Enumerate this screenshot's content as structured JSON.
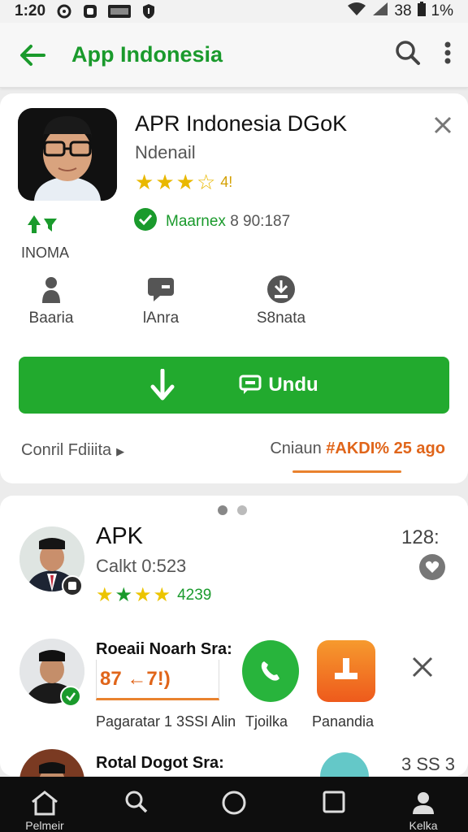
{
  "status_bar": {
    "time": "1:20",
    "battery": "38",
    "percent": "1%"
  },
  "app_bar": {
    "title": "App Indonesia"
  },
  "detail": {
    "app_name": "APR Indonesia DGoK",
    "developer": "Ndenail",
    "rating_value": "4!",
    "verified_label": "Maarnex",
    "verified_number": "8 90:187",
    "update_label": "INOMA",
    "stats": [
      {
        "label": "Baaria",
        "icon": "person-icon"
      },
      {
        "label": "lAnra",
        "icon": "message-icon"
      },
      {
        "label": "S8nata",
        "icon": "download-badge-icon"
      }
    ],
    "install_label": "Undu",
    "footer_left": "Conril Fdiiita",
    "footer_right_prefix": "Cniaun",
    "footer_right_accent": "#AKDI% 25 ago",
    "colors": {
      "accent": "#22aa2e",
      "orange": "#e9822e"
    }
  },
  "list": {
    "items": [
      {
        "title": "APK",
        "subtitle": "Calkt 0:523",
        "rating_value": "4239",
        "meta": "128:"
      },
      {
        "title": "Roeaii Noarh Sra:",
        "box_value": "87 ←7!)",
        "labels": [
          "Pagaratar 1 3SSI Alin",
          "Tjoilka",
          "Panandia"
        ]
      },
      {
        "title": "Rotal Dogot Sra:",
        "meta": "3 SS 3"
      }
    ]
  },
  "nav_bar": {
    "home_label": "Pelmeir",
    "profile_label": "Kelka"
  }
}
